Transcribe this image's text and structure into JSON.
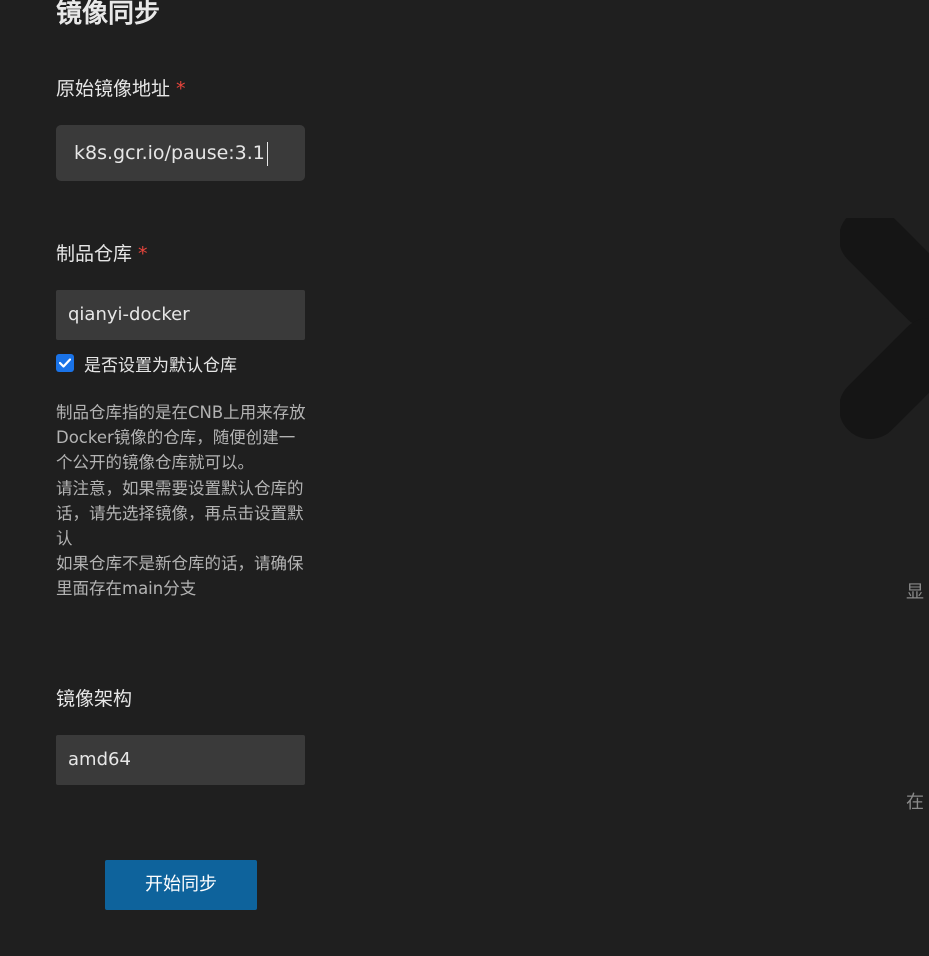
{
  "form": {
    "title": "镜像同步",
    "source_image": {
      "label": "原始镜像地址",
      "required_mark": "*",
      "value": "k8s.gcr.io/pause:3.1"
    },
    "repository": {
      "label": "制品仓库",
      "required_mark": "*",
      "value": "qianyi-docker",
      "default_checkbox": {
        "label": "是否设置为默认仓库",
        "checked": true
      },
      "help": [
        "制品仓库指的是在CNB上用来存放Docker镜像的仓库，随便创建一个公开的镜像仓库就可以。",
        "请注意，如果需要设置默认仓库的话，请先选择镜像，再点击设置默认",
        "如果仓库不是新仓库的话，请确保里面存在main分支"
      ]
    },
    "architecture": {
      "label": "镜像架构",
      "value": "amd64"
    },
    "submit_label": "开始同步"
  },
  "side_panel": {
    "text_1": "显",
    "text_2": "在"
  },
  "colors": {
    "background": "#1f1f1f",
    "input_bg": "#3a3a3a",
    "required": "#e8453c",
    "checkbox": "#1a73e8",
    "button": "#0e639c"
  }
}
